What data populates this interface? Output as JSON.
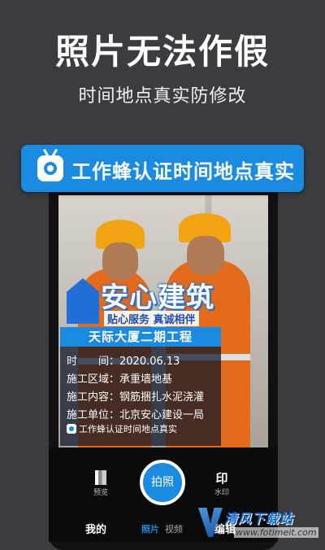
{
  "header": {
    "title": "照片无法作假",
    "subtitle": "时间地点真实防修改"
  },
  "badge": {
    "icon": "camera-icon",
    "text": "工作蜂认证时间地点真实"
  },
  "brand": {
    "name": "安心建筑",
    "slogan": "贴心服务 真诚相伴"
  },
  "watermark_card": {
    "project": "天际大厦二期工程",
    "rows": [
      "时　　间：2020.06.13",
      "施工区域：承重墙地基",
      "施工内容：钢筋捆扎水泥浇灌",
      "施工单位：北京安心建设一局"
    ],
    "verify": "工作蜂认证时间地点真实"
  },
  "camera": {
    "preview_label": "预览",
    "shutter_label": "拍照",
    "watermark_icon": "印",
    "watermark_label": "水印",
    "tabs": [
      "我的",
      "照片",
      "视频",
      "编辑"
    ]
  },
  "site_watermark": {
    "name": "清风下载站",
    "url": "www.fotimeit.com"
  },
  "colors": {
    "accent": "#1a8be0",
    "background": "#3a3c40"
  }
}
